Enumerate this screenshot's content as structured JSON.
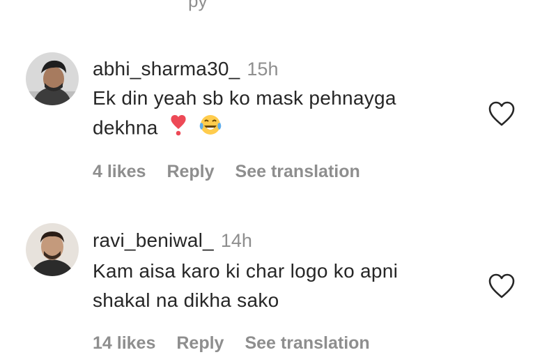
{
  "top_fragment": "py",
  "comments": [
    {
      "username": "abhi_sharma30_",
      "time": "15h",
      "text_line1": "Ek din yeah sb ko mask pehnayga",
      "text_line2": "dekhna",
      "likes": "4 likes",
      "reply": "Reply",
      "translate": "See translation",
      "emojis": [
        "heart-exclamation-icon",
        "tears-of-joy-icon"
      ]
    },
    {
      "username": "ravi_beniwal_",
      "time": "14h",
      "text_line1": "Kam aisa karo ki char logo ko apni",
      "text_line2": "shakal na dikha sako",
      "likes": "14 likes",
      "reply": "Reply",
      "translate": "See translation"
    }
  ],
  "colors": {
    "text": "#262626",
    "secondary": "#8e8e8e",
    "heart": "#ed4956",
    "emoji_face": "#ffcc4d"
  }
}
